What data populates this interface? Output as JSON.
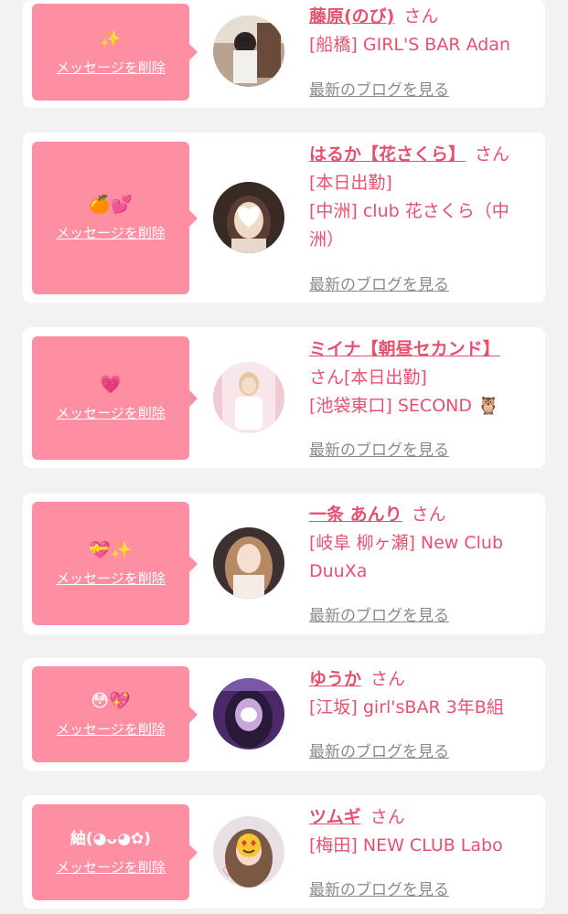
{
  "delete_label": "メッセージを削除",
  "san_label": "さん",
  "blog_label": "最新のブログを見る",
  "colors": {
    "bubble": "#fe8fa3",
    "accent": "#e8506f",
    "link_gray": "#8a8a8a",
    "background": "#f2f2f2"
  },
  "cards": [
    {
      "message": "✨",
      "name": "藤原(のび)",
      "lines": [
        "[船橋] GIRL'S BAR Adan"
      ],
      "avatar": "avatar-photo-mirror-selfie"
    },
    {
      "message": "🍊💕",
      "name": "はるか【花さくら】",
      "lines": [
        "[本日出勤]",
        "[中洲] club 花さくら（中",
        "洲）"
      ],
      "avatar": "avatar-photo-heart-face"
    },
    {
      "message": "💗",
      "name": "ミイナ【朝昼セカンド】",
      "lines": [
        "さん[本日出勤]",
        "[池袋東口] SECOND 🦉"
      ],
      "avatar": "avatar-photo-white-outfit"
    },
    {
      "message": "💝✨",
      "name": "一条 あんり",
      "lines": [
        "[岐阜 柳ヶ瀬] New Club",
        "DuuXa"
      ],
      "avatar": "avatar-photo-long-hair"
    },
    {
      "message": "😳💖",
      "name": "ゆうか",
      "lines": [
        "[江坂] girl'sBAR 3年B組"
      ],
      "avatar": "avatar-photo-purple-light"
    },
    {
      "message": "紬(◕ᴗ◕✿)",
      "name": "ツムギ",
      "lines": [
        "[梅田] NEW CLUB Labo"
      ],
      "avatar": "avatar-photo-heart-eyes-sticker"
    }
  ]
}
